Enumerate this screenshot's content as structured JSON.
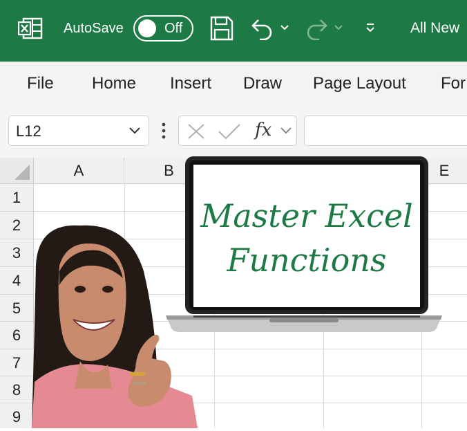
{
  "titlebar": {
    "autosave_label": "AutoSave",
    "autosave_state": "Off",
    "tab_name": "All New",
    "icons": [
      "excel-logo-icon",
      "save-icon",
      "undo-icon",
      "chevron-down-icon",
      "redo-icon",
      "chevron-down-icon",
      "customize-quick-access-icon"
    ],
    "bg_color": "#1e7a45"
  },
  "ribbon": {
    "tabs": [
      "File",
      "Home",
      "Insert",
      "Draw",
      "Page Layout",
      "For"
    ]
  },
  "formula_bar": {
    "name_box": "L12",
    "fx_label": "fx",
    "formula_value": ""
  },
  "grid": {
    "columns": [
      "A",
      "B",
      "E"
    ],
    "rows": [
      "1",
      "2",
      "3",
      "4",
      "5",
      "6",
      "7",
      "8",
      "9"
    ]
  },
  "overlay": {
    "headline_line1": "Master Excel",
    "headline_line2": "Functions",
    "accent_color": "#1e7a45"
  }
}
